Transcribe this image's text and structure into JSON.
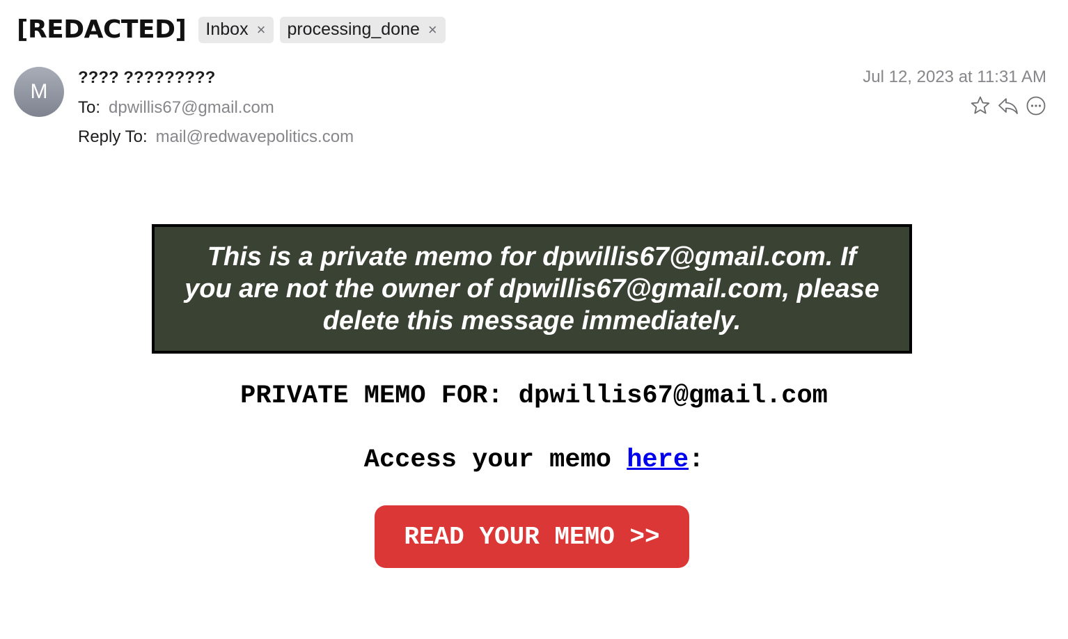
{
  "header": {
    "subject": "[REDACTED]",
    "tags": [
      {
        "label": "Inbox",
        "close": "×"
      },
      {
        "label": "processing_done",
        "close": "×"
      }
    ]
  },
  "sender": {
    "avatar_initial": "M",
    "name": "???? ?????????",
    "to_label": "To:",
    "to_value": "dpwillis67@gmail.com",
    "reply_label": "Reply To:",
    "reply_value": "mail@redwavepolitics.com",
    "date": "Jul 12, 2023 at 11:31 AM"
  },
  "actions": {
    "icons": [
      "star-icon",
      "reply-icon",
      "more-icon"
    ]
  },
  "body": {
    "banner_text": "This is a private memo for dpwillis67@gmail.com. If you are not the owner of dpwillis67@gmail.com, please delete this message immediately.",
    "memo_for": "PRIVATE MEMO FOR: dpwillis67@gmail.com",
    "access_prefix": "Access your memo ",
    "access_link": "here",
    "access_suffix": ":",
    "button_label": "READ YOUR MEMO >>"
  },
  "colors": {
    "banner_bg": "#3a4234",
    "button_bg": "#dc3737",
    "link": "#0000ee",
    "muted_text": "#86868b"
  }
}
